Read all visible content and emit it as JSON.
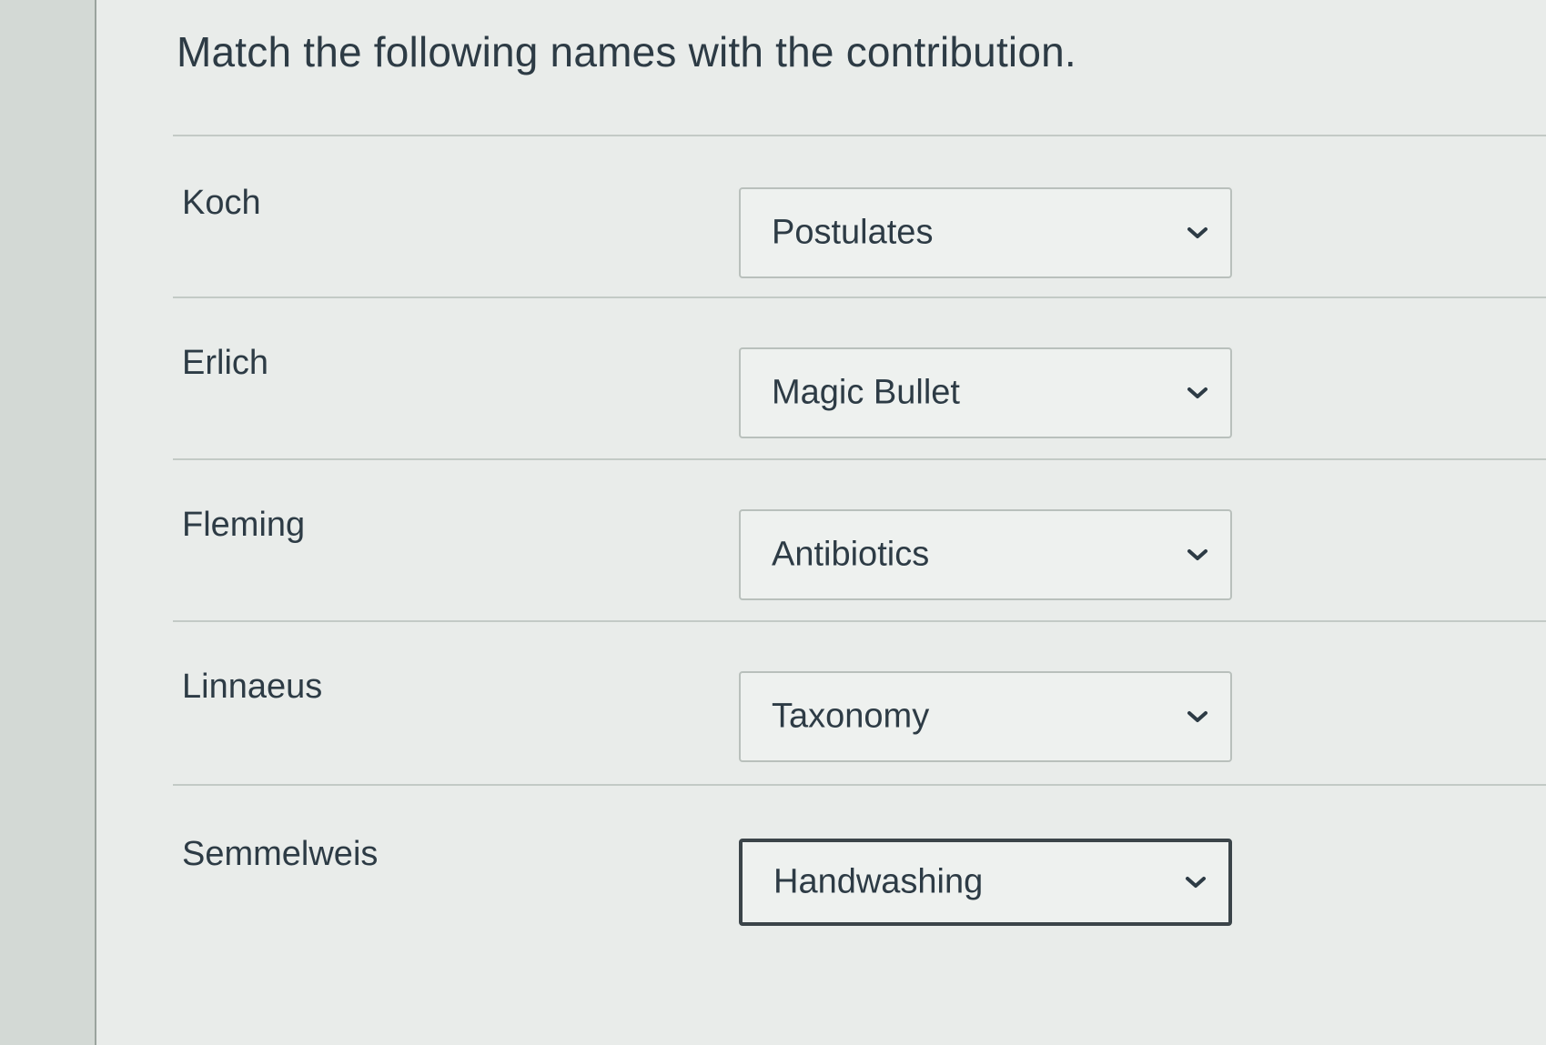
{
  "question": {
    "text": "Match the following names with the contribution."
  },
  "rows": [
    {
      "term": "Koch",
      "answer": "Postulates"
    },
    {
      "term": "Erlich",
      "answer": "Magic Bullet"
    },
    {
      "term": "Fleming",
      "answer": "Antibiotics"
    },
    {
      "term": "Linnaeus",
      "answer": "Taxonomy"
    },
    {
      "term": "Semmelweis",
      "answer": "Handwashing"
    }
  ],
  "icons": {
    "dropdown": "chevron-down-icon"
  },
  "colors": {
    "text": "#2d3b45",
    "panel": "#e9ecea",
    "select_border": "#b9c0bc",
    "focused_border": "#3b4449"
  }
}
